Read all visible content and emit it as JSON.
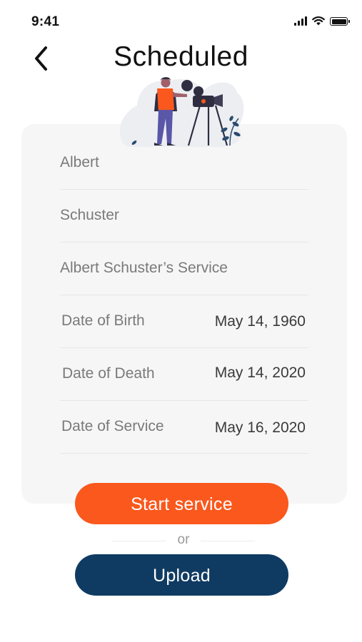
{
  "status_bar": {
    "time": "9:41"
  },
  "header": {
    "title": "Scheduled",
    "back_icon": "chevron-left-icon"
  },
  "card": {
    "illustration": "videographer-with-camera-illustration",
    "first_name": "Albert",
    "last_name": "Schuster",
    "service_name": "Albert Schuster’s Service",
    "details": [
      {
        "label": "Date of Birth",
        "value": "May 14, 1960"
      },
      {
        "label": "Date of Death",
        "value": "May 14, 2020"
      },
      {
        "label": "Date of Service",
        "value": "May 16, 2020"
      }
    ]
  },
  "actions": {
    "start_label": "Start service",
    "or_label": "or",
    "upload_label": "Upload"
  },
  "colors": {
    "start": "#fa581d",
    "upload": "#0f3b62",
    "card": "#f6f6f6"
  }
}
